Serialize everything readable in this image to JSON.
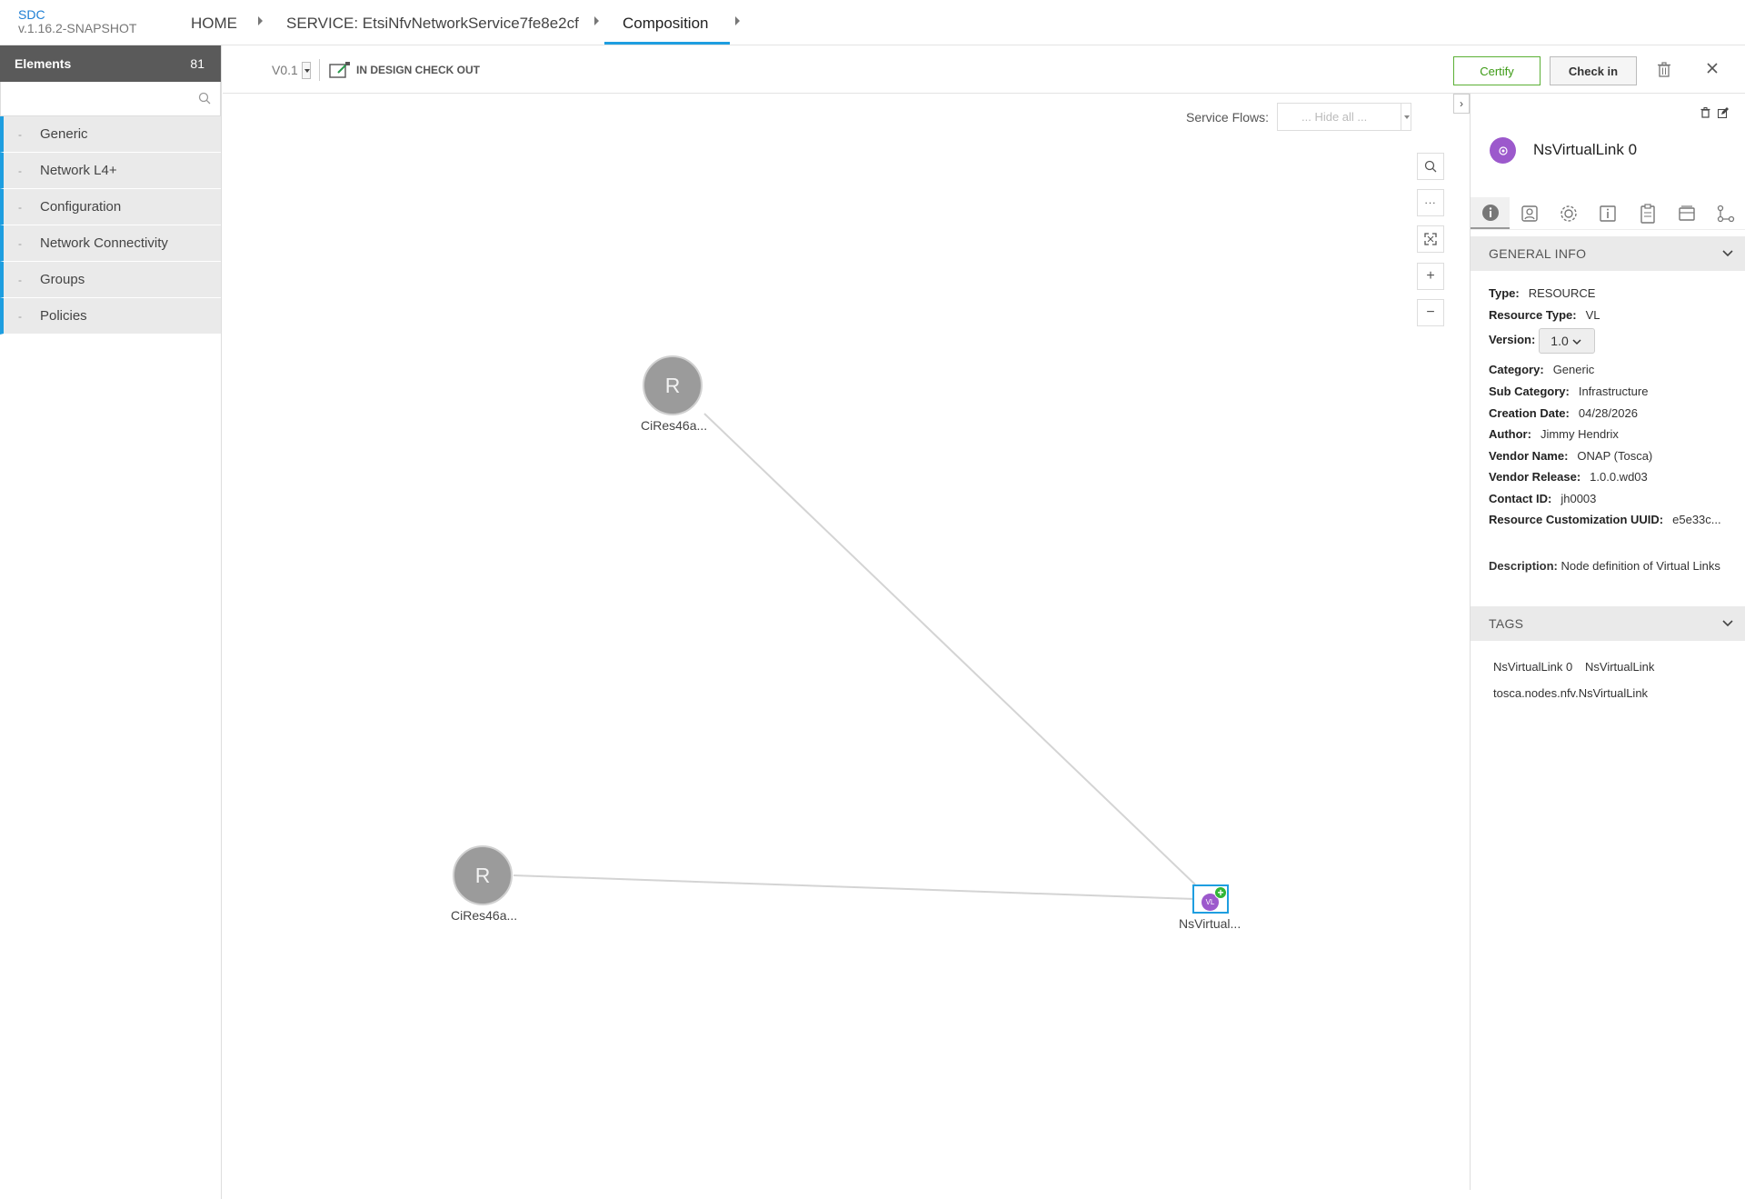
{
  "header": {
    "app_name": "SDC",
    "version": "v.1.16.2-SNAPSHOT",
    "breadcrumbs": [
      "HOME",
      "SERVICE: EtsiNfvNetworkService7fe8e2cf",
      "Composition"
    ]
  },
  "left_panel": {
    "title": "Elements",
    "count": "81",
    "search_placeholder": "",
    "categories": [
      "Generic",
      "Network L4+",
      "Configuration",
      "Network Connectivity",
      "Groups",
      "Policies"
    ]
  },
  "toolbar": {
    "version": "V0.1",
    "status": "IN DESIGN CHECK OUT",
    "certify_label": "Certify",
    "checkin_label": "Check in"
  },
  "canvas": {
    "service_flows_label": "Service Flows:",
    "service_flows_value": "... Hide all ...",
    "nodes": [
      {
        "letter": "R",
        "label": "CiRes46a..."
      },
      {
        "letter": "R",
        "label": "CiRes46a..."
      },
      {
        "icon_text": "VL",
        "label": "NsVirtual..."
      }
    ]
  },
  "right_panel": {
    "title": "NsVirtualLink 0",
    "general_info_title": "GENERAL INFO",
    "type_label": "Type:",
    "type_value": "RESOURCE",
    "resource_type_label": "Resource Type:",
    "resource_type_value": "VL",
    "version_label": "Version:",
    "version_value": "1.0",
    "category_label": "Category:",
    "category_value": "Generic",
    "sub_category_label": "Sub Category:",
    "sub_category_value": "Infrastructure",
    "creation_date_label": "Creation Date:",
    "creation_date_value": "04/28/2026",
    "author_label": "Author:",
    "author_value": "Jimmy Hendrix",
    "vendor_name_label": "Vendor Name:",
    "vendor_name_value": "ONAP (Tosca)",
    "vendor_release_label": "Vendor Release:",
    "vendor_release_value": "1.0.0.wd03",
    "contact_id_label": "Contact ID:",
    "contact_id_value": "jh0003",
    "uuid_label": "Resource Customization UUID:",
    "uuid_value": "e5e33c...",
    "description_label": "Description:",
    "description_value": "Node definition of Virtual Links",
    "tags_title": "TAGS",
    "tags": [
      "NsVirtualLink 0",
      "NsVirtualLink",
      "tosca.nodes.nfv.NsVirtualLink"
    ]
  }
}
